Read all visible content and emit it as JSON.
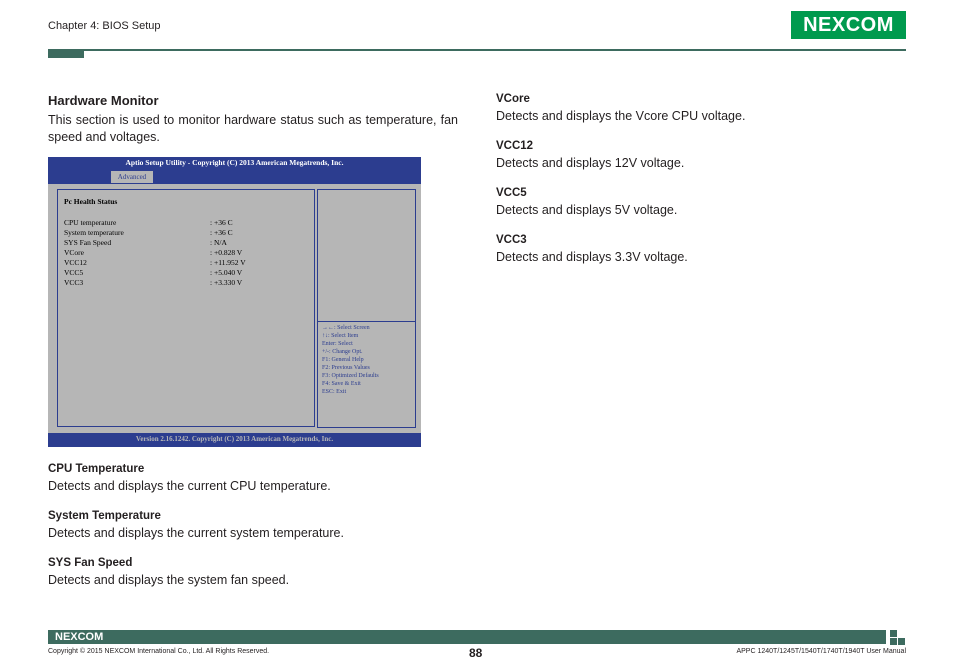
{
  "header": {
    "chapter": "Chapter 4: BIOS Setup",
    "logo": "NEXCOM"
  },
  "left": {
    "section_title": "Hardware Monitor",
    "intro": "This section is used to monitor hardware status such as temperature, fan speed and voltages.",
    "items": [
      {
        "title": "CPU Temperature",
        "desc": "Detects and displays the current CPU temperature."
      },
      {
        "title": "System Temperature",
        "desc": "Detects and displays the current system temperature."
      },
      {
        "title": "SYS Fan Speed",
        "desc": "Detects and displays the system fan speed."
      }
    ]
  },
  "right": {
    "items": [
      {
        "title": "VCore",
        "desc": "Detects and displays the Vcore CPU voltage."
      },
      {
        "title": "VCC12",
        "desc": "Detects and displays 12V voltage."
      },
      {
        "title": "VCC5",
        "desc": "Detects and displays 5V voltage."
      },
      {
        "title": "VCC3",
        "desc": "Detects and displays 3.3V voltage."
      }
    ]
  },
  "bios": {
    "title": "Aptio Setup Utility - Copyright (C) 2013 American Megatrends, Inc.",
    "tab": "Advanced",
    "heading": "Pc Health Status",
    "rows": [
      {
        "label": "CPU temperature",
        "value": ":  +36 C"
      },
      {
        "label": "System temperature",
        "value": ":  +36 C"
      },
      {
        "label": "SYS Fan Speed",
        "value": ":  N/A"
      },
      {
        "label": "VCore",
        "value": ":  +0.828 V"
      },
      {
        "label": "VCC12",
        "value": ":  +11.952 V"
      },
      {
        "label": "VCC5",
        "value": ":  +5.040 V"
      },
      {
        "label": "VCC3",
        "value": ":  +3.330 V"
      }
    ],
    "help": [
      "→←: Select Screen",
      "↑↓: Select Item",
      "Enter: Select",
      "+/-: Change Opt.",
      "F1: General Help",
      "F2: Previous Values",
      "F3: Optimized Defaults",
      "F4: Save & Exit",
      "ESC: Exit"
    ],
    "footer": "Version 2.16.1242. Copyright (C) 2013 American Megatrends, Inc."
  },
  "footer": {
    "logo": "NEXCOM",
    "copyright": "Copyright © 2015 NEXCOM International Co., Ltd. All Rights Reserved.",
    "page": "88",
    "manual": "APPC 1240T/1245T/1540T/1740T/1940T User Manual"
  }
}
